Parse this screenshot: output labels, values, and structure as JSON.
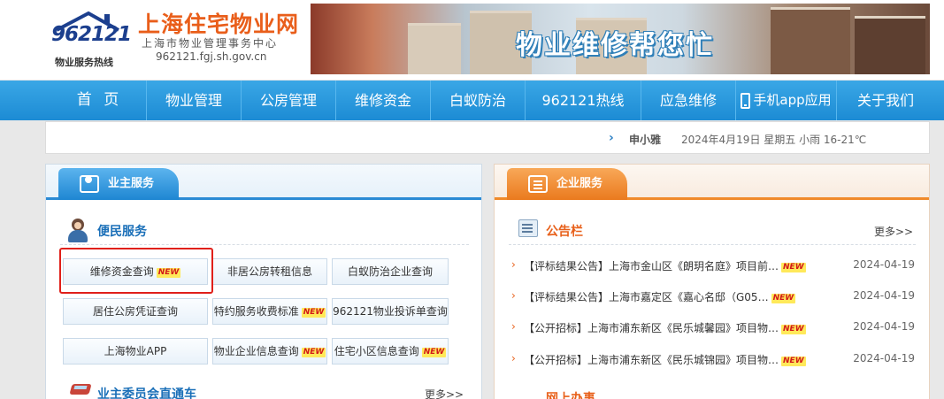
{
  "header": {
    "logo_number": "962121",
    "logo_hotline": "物业服务热线",
    "site_title": "上海住宅物业网",
    "site_subtitle": "上海市物业管理事务中心",
    "site_url": "962121.fgj.sh.gov.cn",
    "banner_text": "物业维修帮您忙"
  },
  "nav": {
    "items": [
      {
        "label": "首 页"
      },
      {
        "label": "物业管理"
      },
      {
        "label": "公房管理"
      },
      {
        "label": "维修资金"
      },
      {
        "label": "白蚁防治"
      },
      {
        "label": "962121热线"
      },
      {
        "label": "应急维修"
      },
      {
        "label": "手机app应用"
      },
      {
        "label": "关于我们"
      }
    ]
  },
  "infobar": {
    "weather_city": "申小雅",
    "weather_text": "2024年4月19日 星期五  小雨  16-21℃"
  },
  "owner_panel": {
    "tab_label": "业主服务",
    "section_title": "便民服务",
    "buttons": [
      {
        "label": "维修资金查询",
        "new": "NEW"
      },
      {
        "label": "非居公房转租信息",
        "new": ""
      },
      {
        "label": "白蚁防治企业查询",
        "new": ""
      },
      {
        "label": "居住公房凭证查询",
        "new": ""
      },
      {
        "label": "特约服务收费标准",
        "new": "NEW"
      },
      {
        "label": "962121物业投诉单查询",
        "new": ""
      },
      {
        "label": "上海物业APP",
        "new": ""
      },
      {
        "label": "物业企业信息查询",
        "new": "NEW"
      },
      {
        "label": "住宅小区信息查询",
        "new": "NEW"
      }
    ],
    "committee_title": "业主委员会直通车",
    "more_label": "更多>>"
  },
  "enterprise_panel": {
    "tab_label": "企业服务",
    "notice_title": "公告栏",
    "more_label": "更多>>",
    "notices": [
      {
        "text": "【评标结果公告】上海市金山区《朗玥名庭》项目前…",
        "new": "NEW",
        "date": "2024-04-19"
      },
      {
        "text": "【评标结果公告】上海市嘉定区《嘉心名邸（G05…",
        "new": "NEW",
        "date": "2024-04-19"
      },
      {
        "text": "【公开招标】上海市浦东新区《民乐城馨园》项目物…",
        "new": "NEW",
        "date": "2024-04-19"
      },
      {
        "text": "【公开招标】上海市浦东新区《民乐城锦园》项目物…",
        "new": "NEW",
        "date": "2024-04-19"
      }
    ],
    "bottom_title": "网上办事"
  },
  "colors": {
    "nav_blue": "#1c8bd4",
    "title_orange": "#e95e1a",
    "highlight_red": "#e0201a"
  }
}
